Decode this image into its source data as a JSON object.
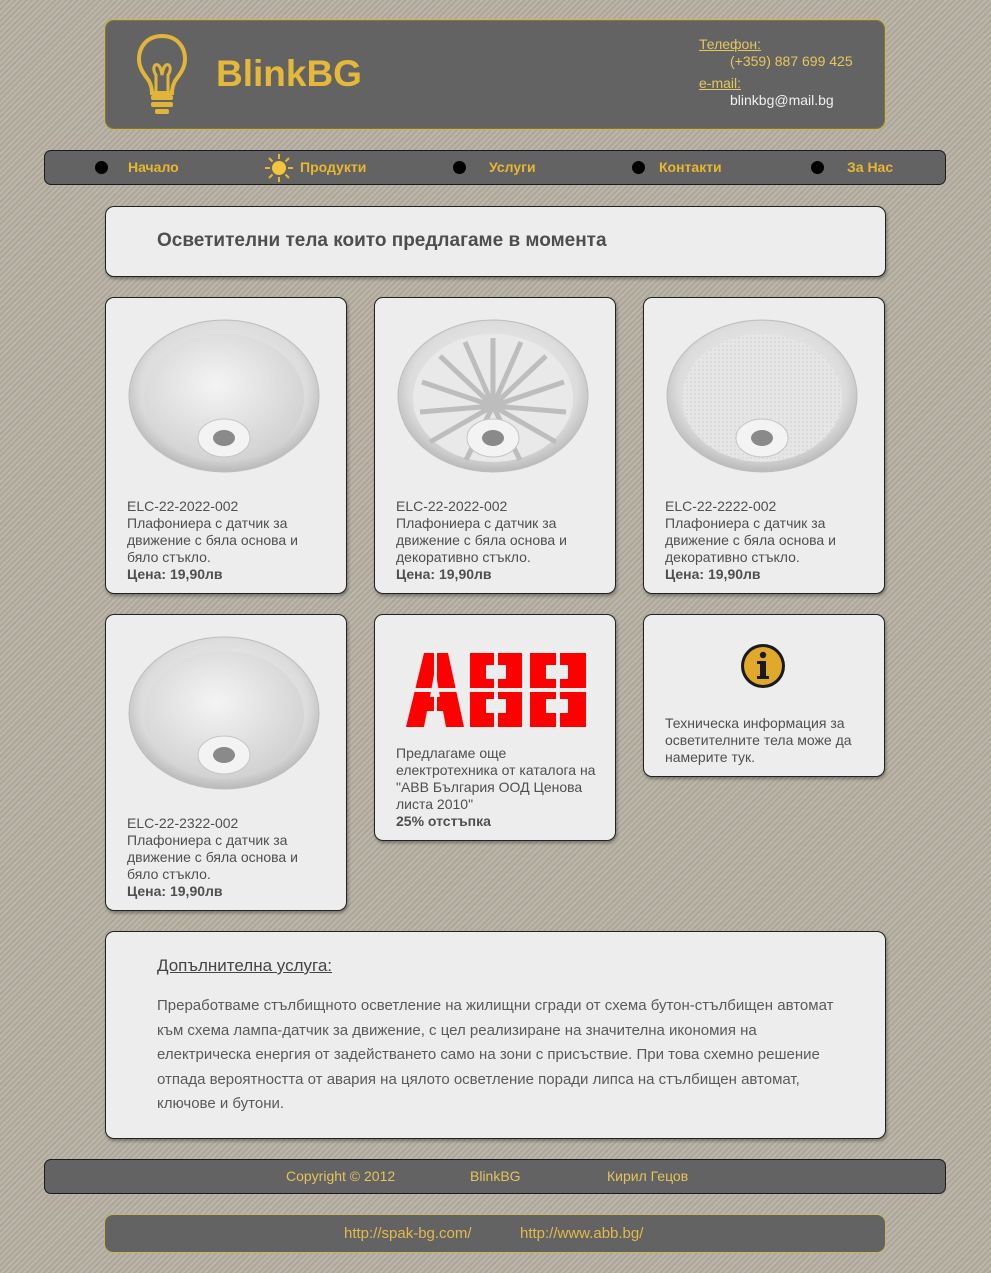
{
  "header": {
    "brand": "BlinkBG",
    "phone_label": "Телефон:",
    "phone": "(+359) 887 699 425",
    "email_label": "e-mail:",
    "email": "blinkbg@mail.bg"
  },
  "nav": {
    "items": [
      {
        "label": "Начало",
        "icon": "bullet-dot"
      },
      {
        "label": "Продукти",
        "icon": "sun-icon"
      },
      {
        "label": "Услуги",
        "icon": "bullet-dot"
      },
      {
        "label": "Контакти",
        "icon": "bullet-dot"
      },
      {
        "label": "За Нас",
        "icon": "bullet-dot"
      }
    ]
  },
  "page_title": "Осветителни тела които предлагаме в момента",
  "products": [
    {
      "code": "ELC-22-2022-002",
      "desc": "Плафониера с датчик за движение с бяла основа и бяло стъкло.",
      "price": "Цена: 19,90лв"
    },
    {
      "code": "ELC-22-2022-002",
      "desc": "Плафониера с датчик за движение с бяла основа и декоративно стъкло.",
      "price": "Цена: 19,90лв"
    },
    {
      "code": "ELC-22-2222-002",
      "desc": "Плафониера с датчик за движение с бяла основа и декоративно стъкло.",
      "price": "Цена: 19,90лв"
    },
    {
      "code": "ELC-22-2322-002",
      "desc": "Плафониера с датчик за движение с бяла основа и бяло стъкло.",
      "price": "Цена: 19,90лв"
    }
  ],
  "abb": {
    "logo_text": "ABB",
    "desc": "Предлагаме още електротехника от каталога на \"ABB България ООД Ценова листа 2010\"",
    "discount": "25% отстъпка"
  },
  "info": {
    "text": "Техническа информация за осветителните тела може да намерите тук."
  },
  "service": {
    "title": "Допълнителна услуга:",
    "text": "Преработваме стълбищното осветление на жилищни сгради от схема бутон-стълбищен автомат към схема лампа-датчик за движение, с цел реализиране на значителна икономия на електрическа енергия от задействането само на зони с присъствие. При това схемно решение отпада вероятността от авария на цялото осветление поради липса на стълбищен автомат, ключове и бутони."
  },
  "footer": {
    "copyright": "Copyright © 2012",
    "brand": "BlinkBG",
    "author": "Кирил Гецов"
  },
  "links": [
    "http://spak-bg.com/",
    "http://www.abb.bg/"
  ],
  "colors": {
    "accent": "#e8b730",
    "header_bg": "#636363",
    "panel_bg": "#ededed",
    "abb_red": "#ff0000"
  }
}
